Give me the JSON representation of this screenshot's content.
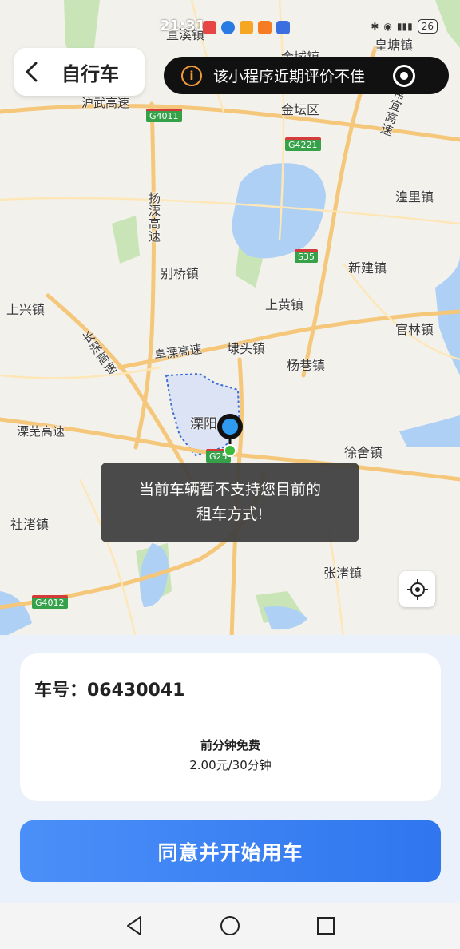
{
  "status_bar": {
    "time": "21:31",
    "battery": "26"
  },
  "header": {
    "title": "自行车"
  },
  "notice": {
    "text": "该小程序近期评价不佳"
  },
  "map": {
    "places": [
      "直溪镇",
      "皇塘镇",
      "金城镇",
      "金坛区",
      "湟里镇",
      "别桥镇",
      "新建镇",
      "上兴镇",
      "上黄镇",
      "官林镇",
      "埭头镇",
      "杨巷镇",
      "溧阳",
      "徐舍镇",
      "社渚镇",
      "张渚镇"
    ],
    "roads": [
      "沪武高速",
      "扬溧高速",
      "长深高速",
      "阜溧高速",
      "溧芜高速",
      "常宜高速"
    ],
    "shields": [
      "G4011",
      "G4221",
      "S35",
      "G4012",
      "G25"
    ]
  },
  "toast": {
    "line1": "当前车辆暂不支持您目前的",
    "line2": "租车方式!"
  },
  "card": {
    "car_number": "车号：06430041",
    "free_label": "前分钟免费",
    "price": "2.00元/30分钟"
  },
  "actions": {
    "start_label": "同意并开始用车"
  }
}
